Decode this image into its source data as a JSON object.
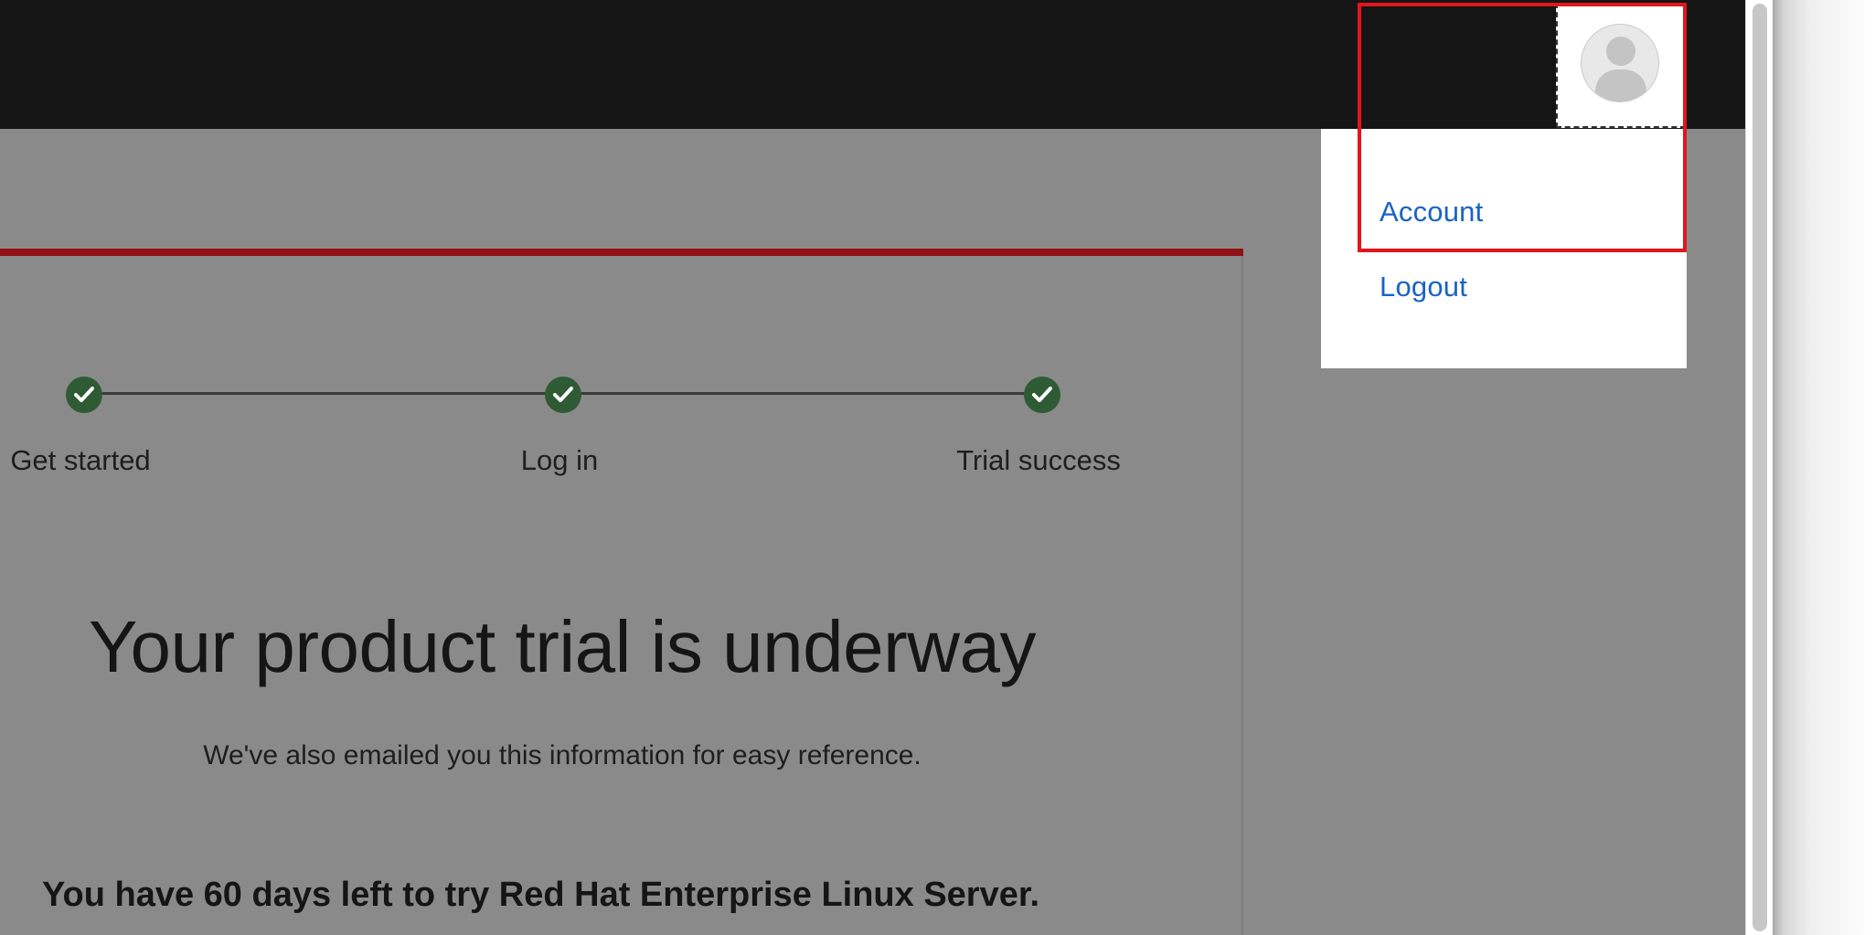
{
  "user_menu": {
    "avatar_alt": "user avatar",
    "items": [
      {
        "label": "Account"
      },
      {
        "label": "Logout"
      }
    ]
  },
  "stepper": {
    "steps": [
      {
        "label": "Get started",
        "status": "complete"
      },
      {
        "label": "Log in",
        "status": "complete"
      },
      {
        "label": "Trial success",
        "status": "complete"
      }
    ]
  },
  "main": {
    "headline": "Your product trial is underway",
    "email_note": "We've also emailed you this information for easy reference.",
    "days_left": "You have 60 days left to try Red Hat Enterprise Linux Server."
  },
  "colors": {
    "accent_red": "#8f1116",
    "link_blue": "#1a63c3",
    "step_complete": "#2f5b34",
    "highlight": "#e4151c"
  }
}
